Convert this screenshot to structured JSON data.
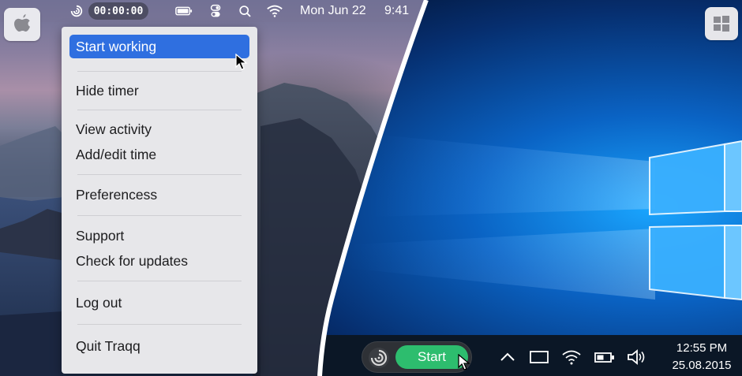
{
  "mac": {
    "menubar": {
      "timer": "00:00:00",
      "date": "Mon Jun 22",
      "time": "9:41",
      "icons": [
        "traqq-icon",
        "battery-icon",
        "control-center-icon",
        "search-icon",
        "wifi-icon"
      ]
    },
    "dock_tile_icon": "apple-logo-icon",
    "menu": {
      "items": [
        {
          "label": "Start working",
          "active": true
        },
        {
          "label": "Hide timer"
        },
        {
          "label": "View activity"
        },
        {
          "label": "Add/edit time"
        },
        {
          "label": "Preferencess"
        },
        {
          "label": "Support"
        },
        {
          "label": "Check for updates"
        },
        {
          "label": "Log out"
        },
        {
          "label": "Quit Traqq"
        }
      ]
    },
    "accent_color": "#2f6fe0"
  },
  "windows": {
    "corner_tile_icon": "windows-logo-icon",
    "traqq_widget": {
      "icon": "traqq-icon",
      "start_label": "Start",
      "start_color": "#2dbd6e"
    },
    "tray": {
      "icons": [
        "chevron-up-icon",
        "tablet-mode-icon",
        "wifi-icon",
        "battery-icon",
        "volume-icon"
      ],
      "time": "12:55 PM",
      "date": "25.08.2015"
    }
  }
}
